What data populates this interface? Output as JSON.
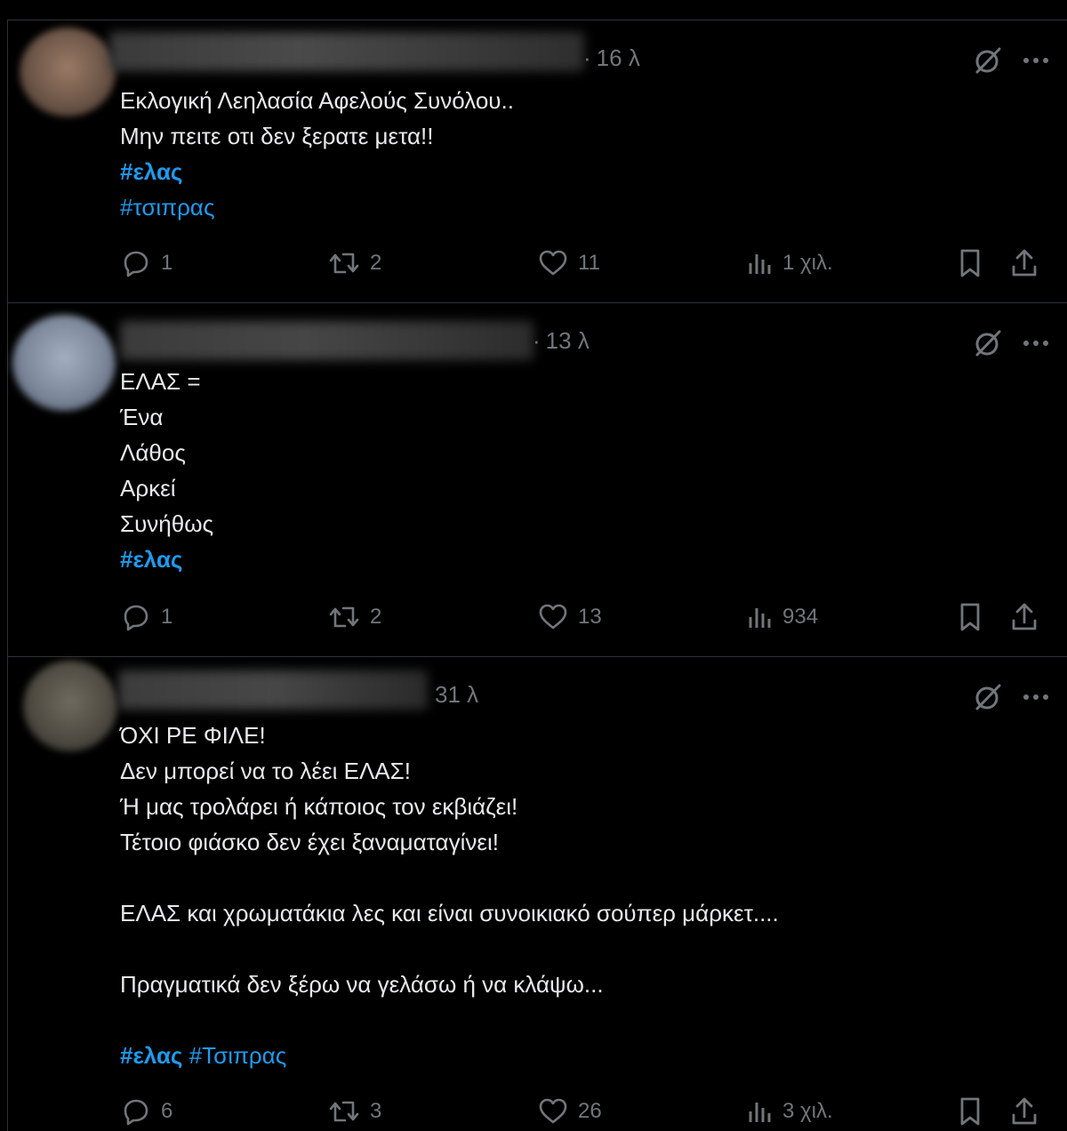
{
  "colors": {
    "background": "#000000",
    "divider": "#2f3336",
    "text": "#e7e9ea",
    "muted": "#71767b",
    "hashtag": "#1d9bf0"
  },
  "posts": [
    {
      "time": "16 λ",
      "lines": [
        "Εκλογική Λεηλασία Αφελούς Συνόλου..",
        "Μην πειτε οτι δεν ξερατε μετα!!"
      ],
      "hashtags": [
        "#ελας",
        "#τσιπρας"
      ],
      "replies": "1",
      "retweets": "2",
      "likes": "11",
      "views": "1 χιλ."
    },
    {
      "time": "13 λ",
      "lines": [
        "ΕΛΑΣ =",
        "Ένα",
        "Λάθος",
        "Αρκεί",
        "Συνήθως"
      ],
      "hashtags": [
        "#ελας"
      ],
      "replies": "1",
      "retweets": "2",
      "likes": "13",
      "views": "934"
    },
    {
      "time": "31 λ",
      "lines": [
        "ΌΧΙ ΡΕ ΦΙΛΕ!",
        "Δεν μπορεί να το λέει ΕΛΑΣ!",
        "Ή μας τρολάρει ή κάποιος τον εκβιάζει!",
        "Τέτοιο φιάσκο δεν έχει ξαναματαγίνει!",
        "ΕΛΑΣ και χρωματάκια λες και είναι συνοικιακό σούπερ μάρκετ....",
        "Πραγματικά δεν ξέρω να γελάσω ή να κλάψω..."
      ],
      "hashtags": [
        "#ελας",
        "#Τσιπρας"
      ],
      "replies": "6",
      "retweets": "3",
      "likes": "26",
      "views": "3 χιλ."
    }
  ]
}
